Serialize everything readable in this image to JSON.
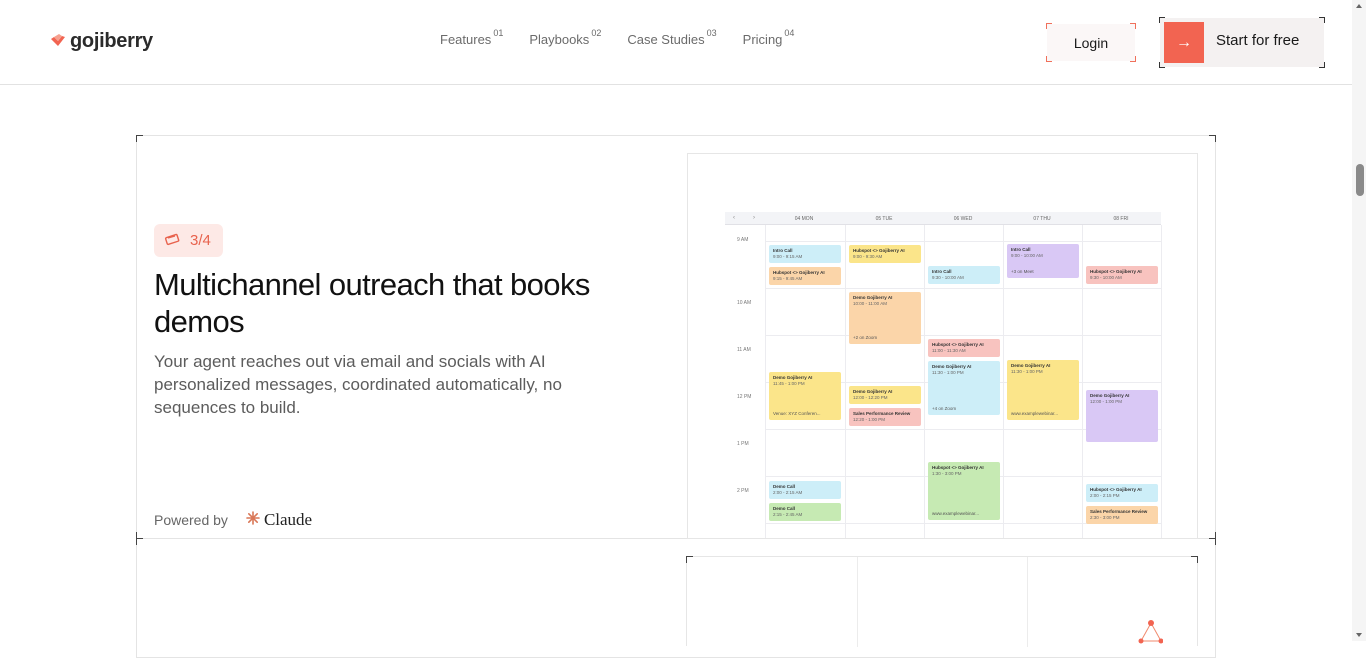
{
  "brand": {
    "name": "gojiberry",
    "accent": "#f26451"
  },
  "nav": [
    {
      "label": "Features",
      "num": "01"
    },
    {
      "label": "Playbooks",
      "num": "02"
    },
    {
      "label": "Case Studies",
      "num": "03"
    },
    {
      "label": "Pricing",
      "num": "04"
    }
  ],
  "header": {
    "login_label": "Login",
    "start_label": "Start for free"
  },
  "feature": {
    "step": "3/4",
    "headline": "Multichannel outreach that books demos",
    "description": "Your agent reaches out via email and socials with AI personalized messages, coordinated automatically, no sequences to build.",
    "powered_by": "Powered by",
    "partner": "Claude"
  },
  "calendar": {
    "days": [
      "04 MON",
      "05 TUE",
      "06 WED",
      "07 THU",
      "08 FRI"
    ],
    "hours": [
      "9 AM",
      "10 AM",
      "11 AM",
      "12 PM",
      "1 PM",
      "2 PM"
    ],
    "events": [
      {
        "title": "Intro Call",
        "time": "9:00 - 9:15 AM",
        "color": "blue"
      },
      {
        "title": "Hubspot <> Gojiberry AI",
        "time": "9:15 - 9:45 AM",
        "color": "orange"
      },
      {
        "title": "Demo Gojiberry AI",
        "time": "11:45 - 1:00 PM",
        "meta": "Venue: XYZ Conferen...",
        "color": "yellow"
      },
      {
        "title": "Demo Call",
        "time": "2:00 - 2:15 AM",
        "color": "blue"
      },
      {
        "title": "Demo Call",
        "time": "2:15 - 2:45 AM",
        "color": "green"
      },
      {
        "title": "Hubspot <> Gojiberry AI",
        "time": "9:00 - 9:30 AM",
        "color": "yellow"
      },
      {
        "title": "Demo Gojiberry AI",
        "time": "10:00 - 11:00 AM",
        "meta": "+2 on Zoom",
        "color": "orange"
      },
      {
        "title": "Demo Gojiberry AI",
        "time": "12:00 - 12:20 PM",
        "color": "yellow"
      },
      {
        "title": "Sales Performance Review",
        "time": "12:20 - 1:00 PM",
        "color": "red"
      },
      {
        "title": "Intro Call",
        "time": "9:30 - 10:00 AM",
        "color": "blue"
      },
      {
        "title": "Hubspot <> Gojiberry AI",
        "time": "11:00 - 11:30 AM",
        "color": "red"
      },
      {
        "title": "Demo Gojiberry AI",
        "time": "11:30 - 1:00 PM",
        "meta": "+4 on Zoom",
        "color": "blue"
      },
      {
        "title": "Hubspot <> Gojiberry AI",
        "time": "1:30 - 3:00 PM",
        "meta": "www.examplewebinar...",
        "color": "green"
      },
      {
        "title": "Intro Call",
        "time": "9:00 - 10:00 AM",
        "meta": "+3 on Meet",
        "color": "purple"
      },
      {
        "title": "Demo Gojiberry AI",
        "time": "11:30 - 1:00 PM",
        "meta": "www.examplewebinar...",
        "color": "yellow"
      },
      {
        "title": "Hubspot <> Gojiberry AI",
        "time": "9:30 - 10:00 AM",
        "color": "red"
      },
      {
        "title": "Demo Gojiberry AI",
        "time": "12:00 - 1:00 PM",
        "color": "purple"
      },
      {
        "title": "Hubspot <> Gojiberry AI",
        "time": "2:00 - 2:15 PM",
        "color": "blue"
      },
      {
        "title": "Sales Performance Review",
        "time": "2:30 - 3:00 PM",
        "color": "orange"
      }
    ]
  }
}
